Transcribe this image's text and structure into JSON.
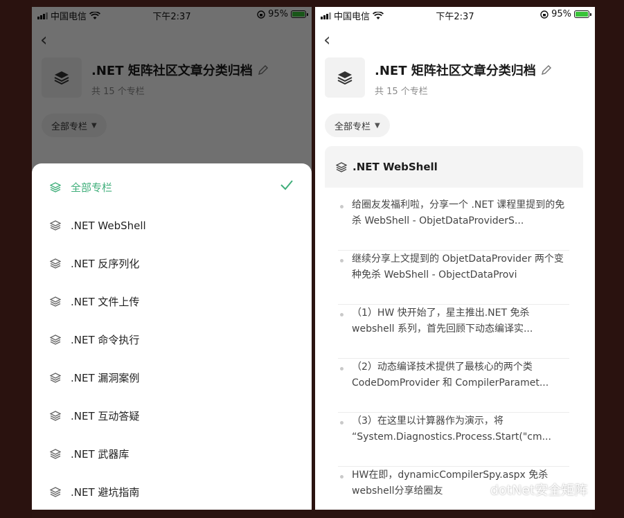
{
  "status_bar": {
    "carrier": "中国电信",
    "time": "下午2:37",
    "battery": "95%",
    "battery_level": 0.95
  },
  "archive": {
    "title": ".NET 矩阵社区文章分类归档",
    "subtitle": "共 15 个专栏",
    "filter_label": "全部专栏",
    "filter_caret": "▼"
  },
  "sheet": {
    "items": [
      {
        "label": "全部专栏",
        "selected": true
      },
      {
        "label": ".NET WebShell"
      },
      {
        "label": ".NET 反序列化"
      },
      {
        "label": ".NET 文件上传"
      },
      {
        "label": ".NET 命令执行"
      },
      {
        "label": ".NET 漏洞案例"
      },
      {
        "label": ".NET 互动答疑"
      },
      {
        "label": ".NET 武器库"
      },
      {
        "label": ".NET 避坑指南"
      }
    ]
  },
  "section": {
    "title": ".NET WebShell",
    "articles": [
      "给圈友发福利啦，分享一个 .NET 课程里提到的免杀 WebShell - ObjetDataProviderS...",
      "继续分享上文提到的 ObjetDataProvider 两个变种免杀 WebShell - ObjectDataProvi",
      "（1）HW 快开始了，星主推出.NET 免杀 webshell 系列，首先回顾下动态编译实...",
      "（2）动态编译技术提供了最核心的两个类 CodeDomProvider 和 CompilerParamet...",
      "（3）在这里以计算器作为演示，将 “System.Diagnostics.Process.Start(\"cm...",
      "HW在即，dynamicCompilerSpy.aspx 免杀 webshell分享给圈友"
    ]
  },
  "watermark": "dotNet安全矩阵",
  "colors": {
    "accent": "#3fae7a",
    "overlay": "rgba(0,0,0,0.56)"
  },
  "icons": [
    "back-icon",
    "layers-icon",
    "edit-icon",
    "check-icon",
    "wifi-icon",
    "lock-rotation-icon",
    "wechat-icon"
  ]
}
